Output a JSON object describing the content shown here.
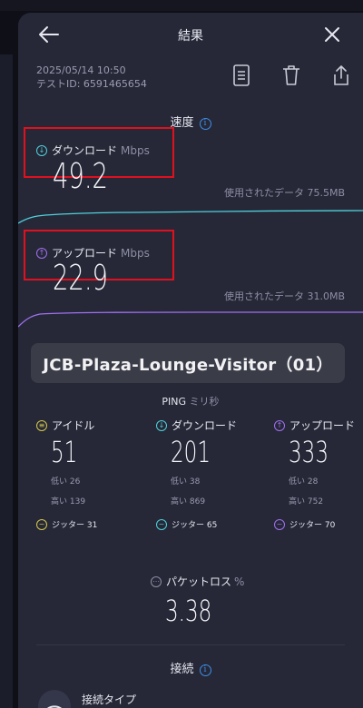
{
  "header": {
    "title": "結果"
  },
  "meta": {
    "datetime": "2025/05/14 10:50",
    "test_id": "テストID: 6591465654"
  },
  "speed": {
    "section_title": "速度",
    "download": {
      "label": "ダウンロード",
      "unit": "Mbps",
      "value": "49.2",
      "used": "使用されたデータ 75.5MB",
      "color": "#4fd1d9"
    },
    "upload": {
      "label": "アップロード",
      "unit": "Mbps",
      "value": "22.9",
      "used": "使用されたデータ 31.0MB",
      "color": "#a070f0"
    }
  },
  "ssid": "JCB-Plaza-Lounge-Visitor（01）",
  "ping": {
    "title": "PING",
    "unit": "ミリ秒",
    "idle": {
      "label": "アイドル",
      "value": "51",
      "low": "低い 26",
      "high": "高い 139",
      "jitter": "ジッター 31",
      "color": "#d4c84a"
    },
    "download": {
      "label": "ダウンロード",
      "value": "201",
      "low": "低い 38",
      "high": "高い 869",
      "jitter": "ジッター 65",
      "color": "#4fd1d9"
    },
    "upload": {
      "label": "アップロード",
      "value": "333",
      "low": "低い 28",
      "high": "高い 752",
      "jitter": "ジッター 70",
      "color": "#a070f0"
    }
  },
  "packet_loss": {
    "label": "パケットロス",
    "unit": "%",
    "value": "3.38"
  },
  "connection": {
    "section_title": "接続",
    "type_label": "接続タイプ"
  }
}
